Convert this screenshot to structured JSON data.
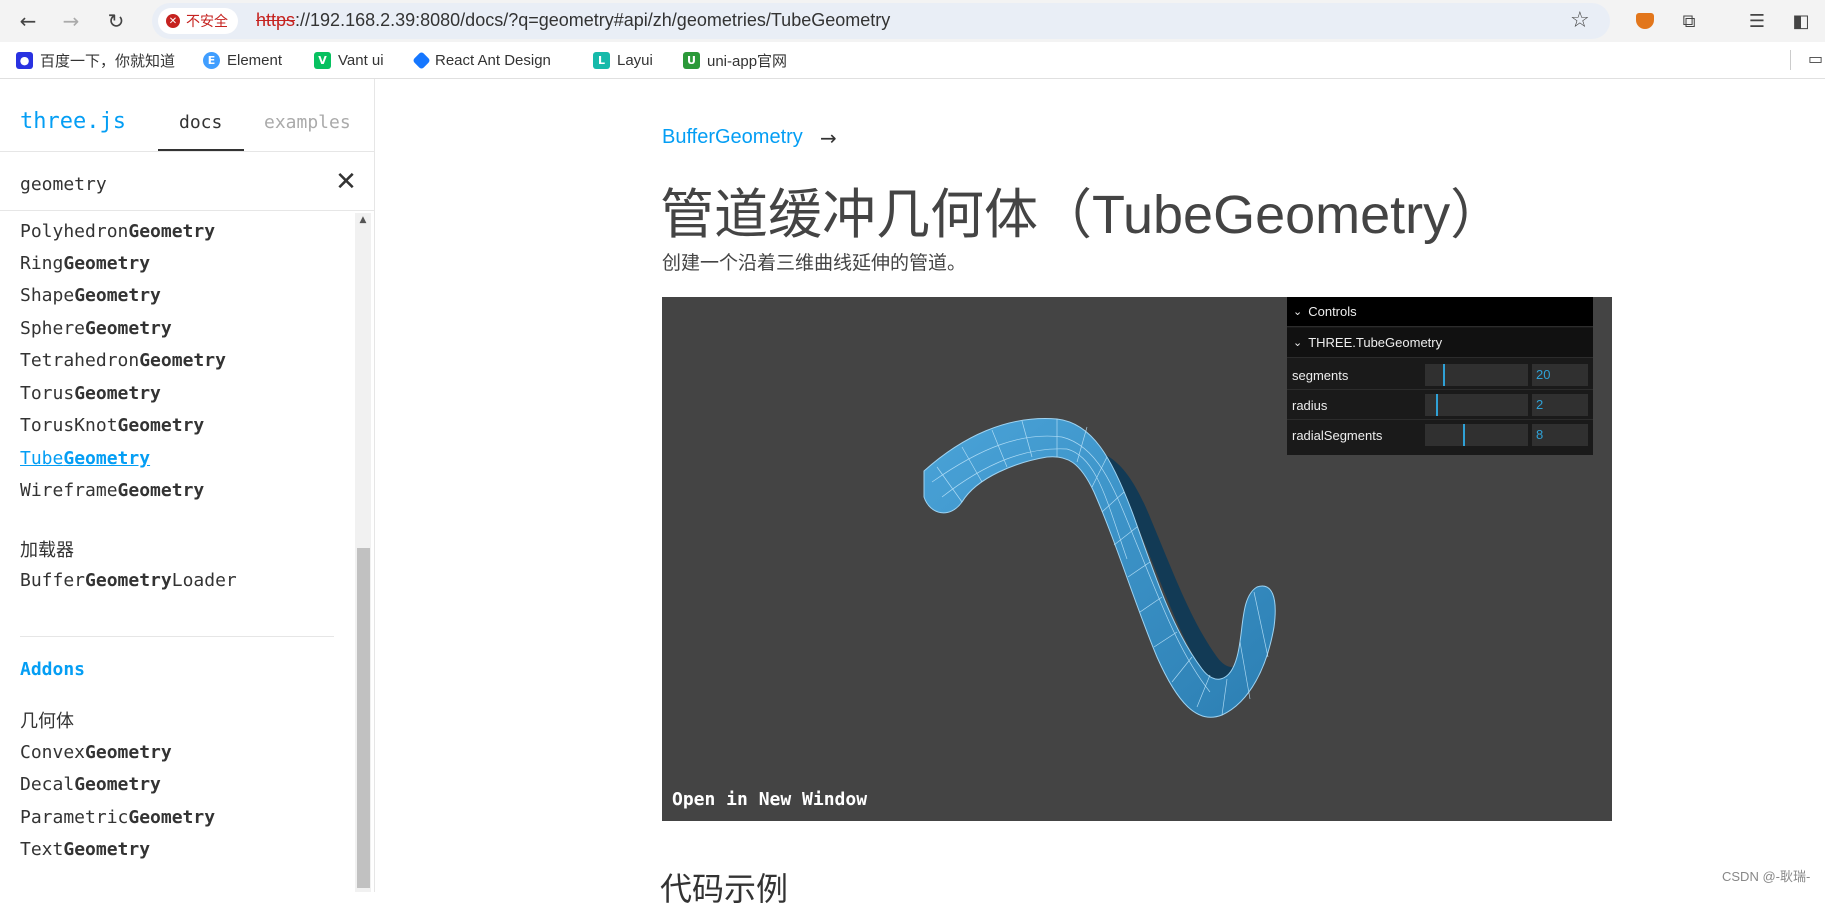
{
  "browser": {
    "security_label": "不安全",
    "url_scheme": "https",
    "url_rest": "://192.168.2.39:8080/docs/?q=geometry#api/zh/geometries/TubeGeometry"
  },
  "bookmarks": [
    {
      "label": "百度一下，你就知道",
      "icon": "paw-icon",
      "color": "#2932e1"
    },
    {
      "label": "Element",
      "icon": "element-icon",
      "color": "#409eff"
    },
    {
      "label": "Vant ui",
      "icon": "vant-icon",
      "color": "#07c160"
    },
    {
      "label": "React Ant Design",
      "icon": "antd-icon",
      "color": "#1677ff"
    },
    {
      "label": "Layui",
      "icon": "layui-icon",
      "color": "#16baaa"
    },
    {
      "label": "uni-app官网",
      "icon": "uniapp-icon",
      "color": "#2b9939"
    }
  ],
  "sidebar": {
    "brand": "three.js",
    "tabs": {
      "docs": "docs",
      "examples": "examples"
    },
    "search_value": "geometry",
    "items": [
      {
        "prefix": "Polyhedron",
        "match": "Geometry",
        "suffix": ""
      },
      {
        "prefix": "Ring",
        "match": "Geometry",
        "suffix": ""
      },
      {
        "prefix": "Shape",
        "match": "Geometry",
        "suffix": ""
      },
      {
        "prefix": "Sphere",
        "match": "Geometry",
        "suffix": ""
      },
      {
        "prefix": "Tetrahedron",
        "match": "Geometry",
        "suffix": ""
      },
      {
        "prefix": "Torus",
        "match": "Geometry",
        "suffix": ""
      },
      {
        "prefix": "TorusKnot",
        "match": "Geometry",
        "suffix": ""
      },
      {
        "prefix": "Tube",
        "match": "Geometry",
        "suffix": ""
      },
      {
        "prefix": "Wireframe",
        "match": "Geometry",
        "suffix": ""
      }
    ],
    "loaders_heading": "加载器",
    "loader_item": {
      "prefix": "Buffer",
      "match": "Geometry",
      "suffix": "Loader"
    },
    "addons": "Addons",
    "addons_heading": "几何体",
    "addons_items": [
      {
        "prefix": "Convex",
        "match": "Geometry",
        "suffix": ""
      },
      {
        "prefix": "Decal",
        "match": "Geometry",
        "suffix": ""
      },
      {
        "prefix": "Parametric",
        "match": "Geometry",
        "suffix": ""
      },
      {
        "prefix": "Text",
        "match": "Geometry",
        "suffix": ""
      }
    ]
  },
  "main": {
    "parent_link": "BufferGeometry",
    "parent_arrow": "→",
    "title": "管道缓冲几何体（TubeGeometry）",
    "description": "创建一个沿着三维曲线延伸的管道。",
    "open_new_window": "Open in New Window",
    "code_heading": "代码示例"
  },
  "gui": {
    "root": "Controls",
    "folder": "THREE.TubeGeometry",
    "controls": [
      {
        "label": "segments",
        "value": "20",
        "fraction": 0.17
      },
      {
        "label": "radius",
        "value": "2",
        "fraction": 0.11
      },
      {
        "label": "radialSegments",
        "value": "8",
        "fraction": 0.37
      }
    ]
  },
  "watermark": "CSDN @-耿瑞-"
}
